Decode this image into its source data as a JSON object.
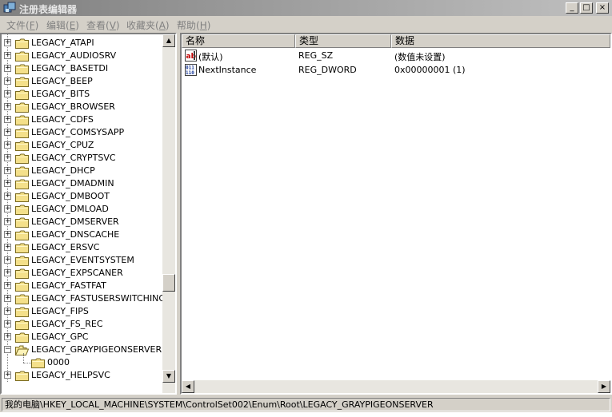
{
  "window": {
    "title": "注册表编辑器",
    "min_label": "_",
    "max_label": "□",
    "close_label": "×"
  },
  "menu": [
    {
      "label": "文件(",
      "key": "F",
      "end": ")"
    },
    {
      "label": "编辑(",
      "key": "E",
      "end": ")"
    },
    {
      "label": "查看(",
      "key": "V",
      "end": ")"
    },
    {
      "label": "收藏夹(",
      "key": "A",
      "end": ")"
    },
    {
      "label": "帮助(",
      "key": "H",
      "end": ")"
    }
  ],
  "tree": {
    "items": [
      {
        "label": "LEGACY_ATAPI",
        "expander": "+"
      },
      {
        "label": "LEGACY_AUDIOSRV",
        "expander": "+"
      },
      {
        "label": "LEGACY_BASETDI",
        "expander": "+"
      },
      {
        "label": "LEGACY_BEEP",
        "expander": "+"
      },
      {
        "label": "LEGACY_BITS",
        "expander": "+"
      },
      {
        "label": "LEGACY_BROWSER",
        "expander": "+"
      },
      {
        "label": "LEGACY_CDFS",
        "expander": "+"
      },
      {
        "label": "LEGACY_COMSYSAPP",
        "expander": "+"
      },
      {
        "label": "LEGACY_CPUZ",
        "expander": "+"
      },
      {
        "label": "LEGACY_CRYPTSVC",
        "expander": "+"
      },
      {
        "label": "LEGACY_DHCP",
        "expander": "+"
      },
      {
        "label": "LEGACY_DMADMIN",
        "expander": "+"
      },
      {
        "label": "LEGACY_DMBOOT",
        "expander": "+"
      },
      {
        "label": "LEGACY_DMLOAD",
        "expander": "+"
      },
      {
        "label": "LEGACY_DMSERVER",
        "expander": "+"
      },
      {
        "label": "LEGACY_DNSCACHE",
        "expander": "+"
      },
      {
        "label": "LEGACY_ERSVC",
        "expander": "+"
      },
      {
        "label": "LEGACY_EVENTSYSTEM",
        "expander": "+"
      },
      {
        "label": "LEGACY_EXPSCANER",
        "expander": "+"
      },
      {
        "label": "LEGACY_FASTFAT",
        "expander": "+"
      },
      {
        "label": "LEGACY_FASTUSERSWITCHINGC",
        "expander": "+"
      },
      {
        "label": "LEGACY_FIPS",
        "expander": "+"
      },
      {
        "label": "LEGACY_FS_REC",
        "expander": "+"
      },
      {
        "label": "LEGACY_GPC",
        "expander": "+"
      },
      {
        "label": "LEGACY_GRAYPIGEONSERVER",
        "expander": "−"
      },
      {
        "label": "0000",
        "expander": ""
      },
      {
        "label": "LEGACY_HELPSVC",
        "expander": "+"
      }
    ],
    "scroll_up": "▲",
    "scroll_down": "▼"
  },
  "list": {
    "columns": [
      "名称",
      "类型",
      "数据"
    ],
    "rows": [
      {
        "name": "(默认)",
        "type": "REG_SZ",
        "data": "(数值未设置)",
        "icon": "string-value-icon"
      },
      {
        "name": "NextInstance",
        "type": "REG_DWORD",
        "data": "0x00000001 (1)",
        "icon": "binary-value-icon"
      }
    ],
    "scroll_left": "◀",
    "scroll_right": "▶"
  },
  "status": {
    "path": "我的电脑\\HKEY_LOCAL_MACHINE\\SYSTEM\\ControlSet002\\Enum\\Root\\LEGACY_GRAYPIGEONSERVER"
  }
}
